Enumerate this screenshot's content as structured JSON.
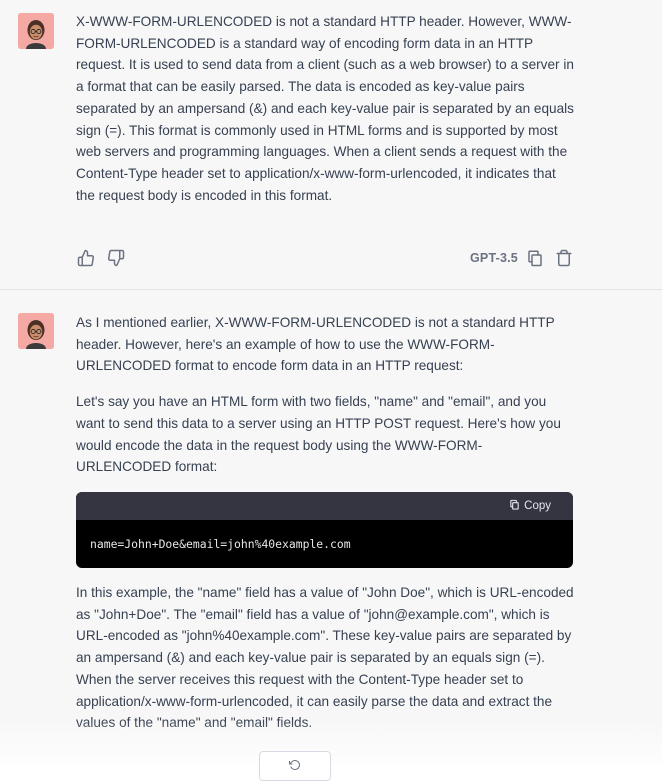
{
  "messages": [
    {
      "paragraphs": [
        "X-WWW-FORM-URLENCODED is not a standard HTTP header. However, WWW-FORM-URLENCODED is a standard way of encoding form data in an HTTP request. It is used to send data from a client (such as a web browser) to a server in a format that can be easily parsed. The data is encoded as key-value pairs separated by an ampersand (&) and each key-value pair is separated by an equals sign (=). This format is commonly used in HTML forms and is supported by most web servers and programming languages. When a client sends a request with the Content-Type header set to application/x-www-form-urlencoded, it indicates that the request body is encoded in this format."
      ],
      "model_label": "GPT-3.5"
    },
    {
      "paragraphs": [
        "As I mentioned earlier, X-WWW-FORM-URLENCODED is not a standard HTTP header. However, here's an example of how to use the WWW-FORM-URLENCODED format to encode form data in an HTTP request:",
        "Let's say you have an HTML form with two fields, \"name\" and \"email\", and you want to send this data to a server using an HTTP POST request. Here's how you would encode the data in the request body using the WWW-FORM-URLENCODED format:"
      ],
      "code": {
        "copy_label": "Copy",
        "content": "name=John+Doe&email=john%40example.com"
      },
      "after_paragraph": "In this example, the \"name\" field has a value of \"John Doe\", which is URL-encoded as \"John+Doe\". The \"email\" field has a value of \"john@example.com\", which is URL-encoded as \"john%40example.com\". These key-value pairs are separated by an ampersand (&) and each key-value pair is separated by an equals sign (=). When the server receives this request with the Content-Type header set to application/x-www-form-urlencoded, it can easily parse the data and extract the values of the \"name\" and \"email\" fields."
    }
  ],
  "icons": {
    "thumbs_up": "thumbs-up-icon",
    "thumbs_down": "thumbs-down-icon",
    "copy": "copy-icon",
    "trash": "trash-icon",
    "avatar": "memoji-avatar"
  },
  "colors": {
    "message_bg": "#f7f7f8",
    "avatar_bg": "#f4a9a4",
    "code_bg": "#000000",
    "code_header_bg": "#343541"
  }
}
